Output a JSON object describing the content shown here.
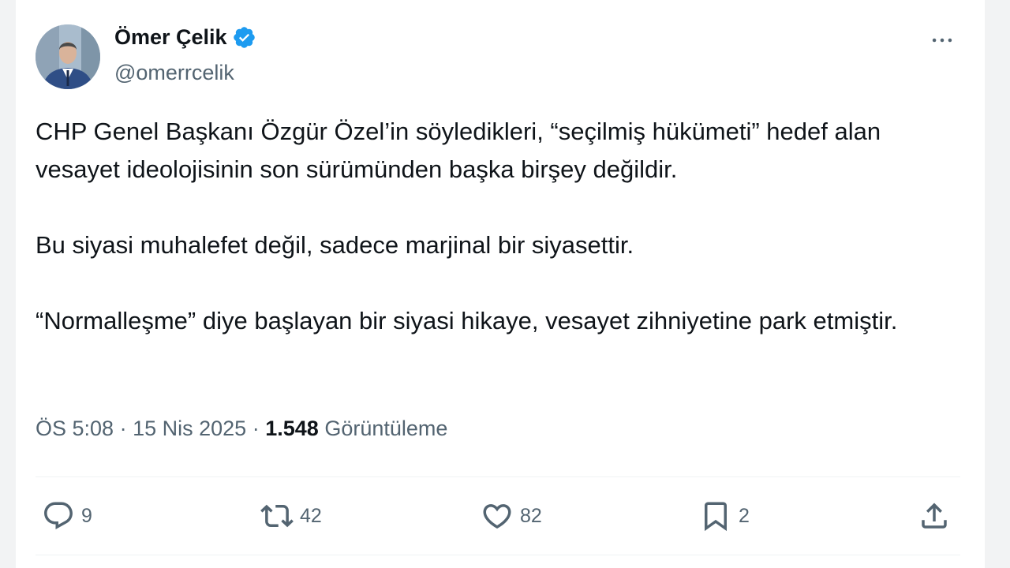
{
  "author": {
    "name": "Ömer Çelik",
    "handle": "@omerrcelik",
    "verified": true,
    "verified_color": "#1d9bf0"
  },
  "tweet": {
    "paragraphs": [
      "CHP Genel Başkanı Özgür Özel’in söyledikleri, “seçilmiş hükümeti” hedef alan vesayet ideolojisinin son sürümünden başka birşey değildir.",
      "Bu siyasi muhalefet değil, sadece marjinal bir siyasettir.",
      "“Normalleşme” diye başlayan bir siyasi hikaye, vesayet zihniyetine park etmiştir."
    ]
  },
  "meta": {
    "time": "ÖS 5:08",
    "separator": "·",
    "date": "15 Nis 2025",
    "views_count": "1.548",
    "views_label": "Görüntüleme"
  },
  "actions": {
    "reply_count": "9",
    "retweet_count": "42",
    "like_count": "82",
    "bookmark_count": "2"
  },
  "icons": {
    "more": "more-dots-icon",
    "reply": "reply-icon",
    "retweet": "retweet-icon",
    "like": "heart-icon",
    "bookmark": "bookmark-icon",
    "share": "share-icon"
  },
  "colors": {
    "text": "#0f1419",
    "muted": "#536471",
    "divider": "#eff3f4",
    "background": "#ffffff"
  }
}
